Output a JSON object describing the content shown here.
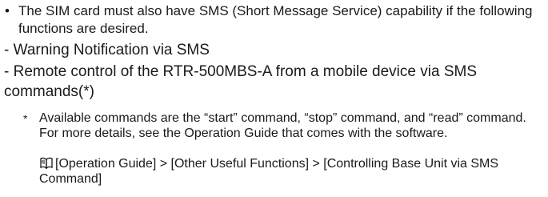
{
  "bullet": {
    "marker": "•",
    "text": "The SIM card must also have SMS (Short Message Service) capability if the following functions are desired."
  },
  "functions": [
    "- Warning Notification via SMS",
    "- Remote control of the RTR-500MBS-A from a mobile device via SMS",
    "commands(*)"
  ],
  "note": {
    "marker": "*",
    "text": "Available commands are the “start” command, “stop” command, and “read” command. For more details, see the Operation Guide that comes with the software."
  },
  "reference": {
    "icon": "book-icon",
    "text": "[Operation Guide] > [Other Useful Functions] > [Controlling Base Unit via SMS Command]"
  }
}
